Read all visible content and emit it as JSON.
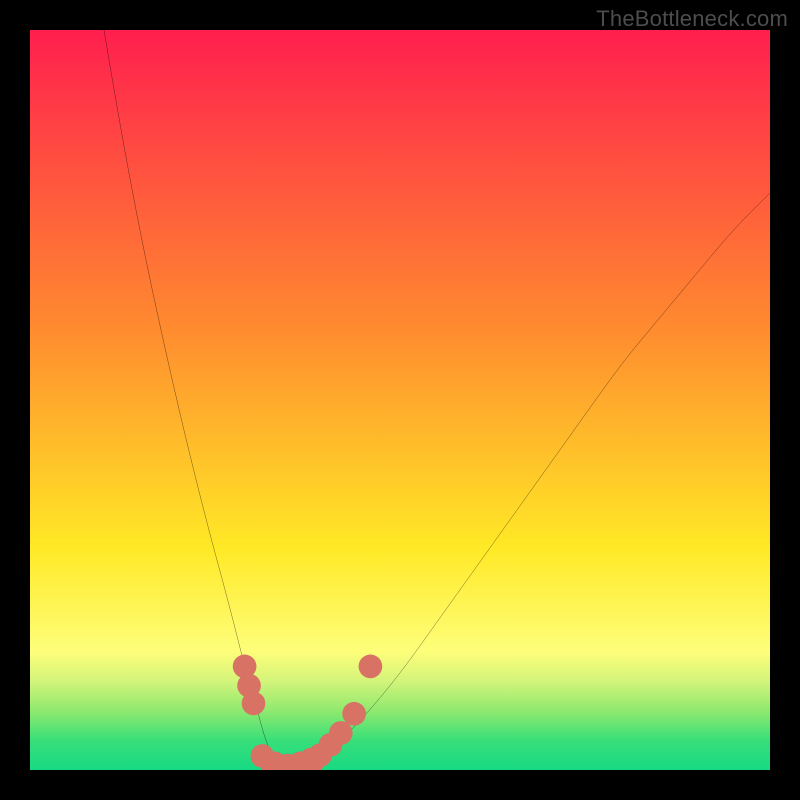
{
  "watermark": "TheBottleneck.com",
  "chart_data": {
    "type": "line",
    "title": "",
    "xlabel": "",
    "ylabel": "",
    "xlim": [
      0,
      100
    ],
    "ylim": [
      0,
      100
    ],
    "grid": false,
    "legend": false,
    "annotations": [],
    "background_gradient": {
      "stops": [
        {
          "t": 0.0,
          "color": "#ff1f4e"
        },
        {
          "t": 0.4,
          "color": "#ff8a2f"
        },
        {
          "t": 0.7,
          "color": "#ffe926"
        },
        {
          "t": 0.84,
          "color": "#fefe7a"
        },
        {
          "t": 0.88,
          "color": "#d3f47a"
        },
        {
          "t": 0.92,
          "color": "#8fe96f"
        },
        {
          "t": 0.96,
          "color": "#38df79"
        },
        {
          "t": 1.0,
          "color": "#17d983"
        }
      ]
    },
    "series": [
      {
        "name": "curve",
        "x": [
          10,
          12,
          15,
          18,
          21,
          24,
          27,
          29,
          30.5,
          31.5,
          33,
          35,
          37,
          40,
          45,
          50,
          55,
          60,
          65,
          70,
          75,
          80,
          85,
          90,
          95,
          100
        ],
        "y": [
          100,
          88,
          72,
          58,
          45,
          33,
          22,
          14,
          9,
          5,
          1,
          0,
          0.4,
          2,
          7,
          13,
          20,
          27,
          34,
          41,
          48,
          55,
          61,
          67,
          73,
          78
        ]
      }
    ],
    "markers": {
      "name": "dots",
      "color": "#d77264",
      "points": [
        {
          "x": 29.0,
          "y": 14.0,
          "r": 1.6
        },
        {
          "x": 29.6,
          "y": 11.4,
          "r": 1.6
        },
        {
          "x": 30.2,
          "y": 9.0,
          "r": 1.6
        },
        {
          "x": 31.4,
          "y": 1.9,
          "r": 1.6
        },
        {
          "x": 33.0,
          "y": 0.7,
          "r": 1.8
        },
        {
          "x": 34.8,
          "y": 0.4,
          "r": 1.8
        },
        {
          "x": 36.6,
          "y": 0.7,
          "r": 1.8
        },
        {
          "x": 38.0,
          "y": 1.2,
          "r": 1.8
        },
        {
          "x": 39.2,
          "y": 2.0,
          "r": 1.6
        },
        {
          "x": 40.6,
          "y": 3.4,
          "r": 1.6
        },
        {
          "x": 42.0,
          "y": 5.0,
          "r": 1.6
        },
        {
          "x": 43.8,
          "y": 7.6,
          "r": 1.6
        },
        {
          "x": 46.0,
          "y": 14.0,
          "r": 1.6
        }
      ]
    }
  }
}
